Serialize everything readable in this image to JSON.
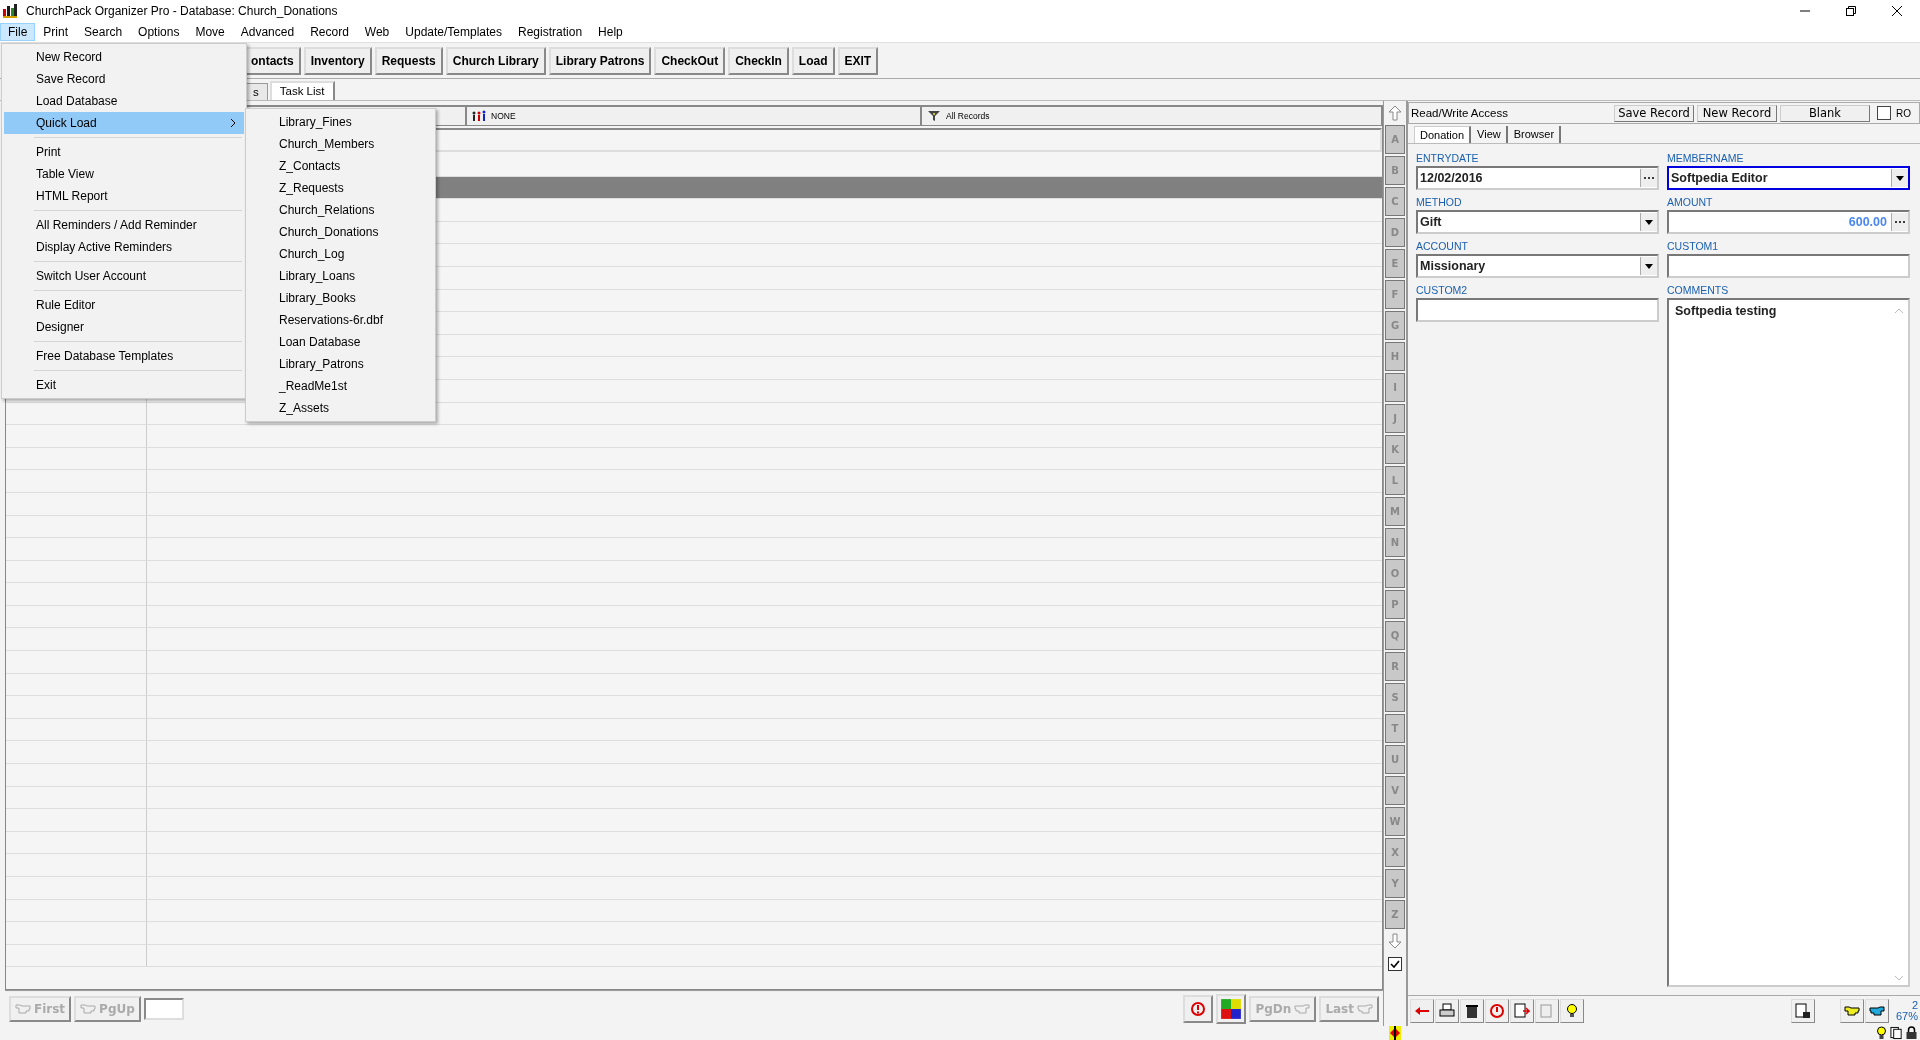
{
  "window": {
    "title": "ChurchPack Organizer Pro - Database: Church_Donations"
  },
  "menu_bar": [
    {
      "label": "File",
      "selected": true
    },
    {
      "label": "Print",
      "selected": false
    },
    {
      "label": "Search",
      "selected": false
    },
    {
      "label": "Options",
      "selected": false
    },
    {
      "label": "Move",
      "selected": false
    },
    {
      "label": "Advanced",
      "selected": false
    },
    {
      "label": "Record",
      "selected": false
    },
    {
      "label": "Web",
      "selected": false
    },
    {
      "label": "Update/Templates",
      "selected": false
    },
    {
      "label": "Registration",
      "selected": false
    },
    {
      "label": "Help",
      "selected": false
    }
  ],
  "file_menu": {
    "groups": [
      [
        {
          "label": "New Record",
          "selected": false,
          "submenu": false
        },
        {
          "label": "Save Record",
          "selected": false,
          "submenu": false
        },
        {
          "label": "Load Database",
          "selected": false,
          "submenu": false
        },
        {
          "label": "Quick Load",
          "selected": true,
          "submenu": true
        }
      ],
      [
        {
          "label": "Print",
          "selected": false,
          "submenu": false
        },
        {
          "label": "Table View",
          "selected": false,
          "submenu": false
        },
        {
          "label": "HTML Report",
          "selected": false,
          "submenu": false
        }
      ],
      [
        {
          "label": "All Reminders / Add Reminder",
          "selected": false,
          "submenu": false
        },
        {
          "label": "Display Active Reminders",
          "selected": false,
          "submenu": false
        }
      ],
      [
        {
          "label": "Switch User Account",
          "selected": false,
          "submenu": false
        }
      ],
      [
        {
          "label": "Rule Editor",
          "selected": false,
          "submenu": false
        },
        {
          "label": "Designer",
          "selected": false,
          "submenu": false
        }
      ],
      [
        {
          "label": "Free Database Templates",
          "selected": false,
          "submenu": false
        }
      ],
      [
        {
          "label": "Exit",
          "selected": false,
          "submenu": false
        }
      ]
    ]
  },
  "quick_load_menu": [
    "Library_Fines",
    "Church_Members",
    "Z_Contacts",
    "Z_Requests",
    "Church_Relations",
    "Church_Donations",
    "Church_Log",
    "Library_Loans",
    "Library_Books",
    "Reservations-6r.dbf",
    "Loan Database",
    "Library_Patrons",
    "_ReadMe1st",
    "Z_Assets"
  ],
  "toolbar": [
    "ontacts",
    "Inventory",
    "Requests",
    "Church Library",
    "Library Patrons",
    "CheckOut",
    "CheckIn",
    "Load",
    "EXIT"
  ],
  "view_tabs": [
    {
      "label": "s",
      "selected": false
    },
    {
      "label": "Task List",
      "selected": true
    }
  ],
  "grid": {
    "group_filter": "NONE",
    "record_filter": "All Records",
    "rows": [
      {
        "selected": false
      },
      {
        "selected": true
      },
      {
        "selected": false
      },
      {
        "selected": false
      },
      {
        "selected": false
      },
      {
        "selected": false
      },
      {
        "selected": false
      },
      {
        "selected": false
      },
      {
        "selected": false
      },
      {
        "selected": false
      },
      {
        "selected": false
      },
      {
        "selected": false
      },
      {
        "selected": false
      },
      {
        "selected": false
      },
      {
        "selected": false
      },
      {
        "selected": false
      },
      {
        "selected": false
      },
      {
        "selected": false
      },
      {
        "selected": false
      },
      {
        "selected": false
      },
      {
        "selected": false
      },
      {
        "selected": false
      },
      {
        "selected": false
      },
      {
        "selected": false
      },
      {
        "selected": false
      },
      {
        "selected": false
      },
      {
        "selected": false
      },
      {
        "selected": false
      },
      {
        "selected": false
      },
      {
        "selected": false
      },
      {
        "selected": false
      },
      {
        "selected": false
      },
      {
        "selected": false
      },
      {
        "selected": false
      },
      {
        "selected": false
      },
      {
        "selected": false
      }
    ]
  },
  "left_nav": [
    {
      "label": "First",
      "disabled": true
    },
    {
      "label": "PgUp",
      "disabled": true
    }
  ],
  "right_nav": [
    {
      "label": "PgDn",
      "disabled": true
    },
    {
      "label": "Last",
      "disabled": true
    }
  ],
  "alpha_bar": {
    "letters": [
      "A",
      "B",
      "C",
      "D",
      "E",
      "F",
      "G",
      "H",
      "I",
      "J",
      "K",
      "L",
      "M",
      "N",
      "O",
      "P",
      "Q",
      "R",
      "S",
      "T",
      "U",
      "V",
      "W",
      "X",
      "Y",
      "Z"
    ],
    "checked": true
  },
  "record_panel": {
    "access": "Read/Write Access",
    "buttons": [
      "Save Record",
      "New Record",
      "Blank"
    ],
    "read_only": {
      "label": "RO",
      "checked": false
    },
    "tabs": [
      {
        "label": "Donation",
        "selected": true
      },
      {
        "label": "View",
        "selected": false
      },
      {
        "label": "Browser",
        "selected": false
      }
    ],
    "fields": [
      {
        "label": "ENTRYDATE",
        "value": "12/02/2016",
        "kind": "date",
        "focused": false
      },
      {
        "label": "MEMBERNAME",
        "value": "Softpedia Editor",
        "kind": "combo",
        "focused": true
      },
      {
        "label": "METHOD",
        "value": "Gift",
        "kind": "combo",
        "focused": false
      },
      {
        "label": "AMOUNT",
        "value": "600.00",
        "kind": "number",
        "focused": false
      },
      {
        "label": "ACCOUNT",
        "value": "Missionary",
        "kind": "combo",
        "focused": false
      },
      {
        "label": "CUSTOM1",
        "kind": "text",
        "focused": false
      },
      {
        "label": "CUSTOM2",
        "kind": "text",
        "focused": false
      },
      {
        "label": "COMMENTS",
        "value": "Softpedia testing",
        "kind": "memo",
        "focused": false
      }
    ],
    "record_number": "2",
    "zoom": "67%"
  }
}
